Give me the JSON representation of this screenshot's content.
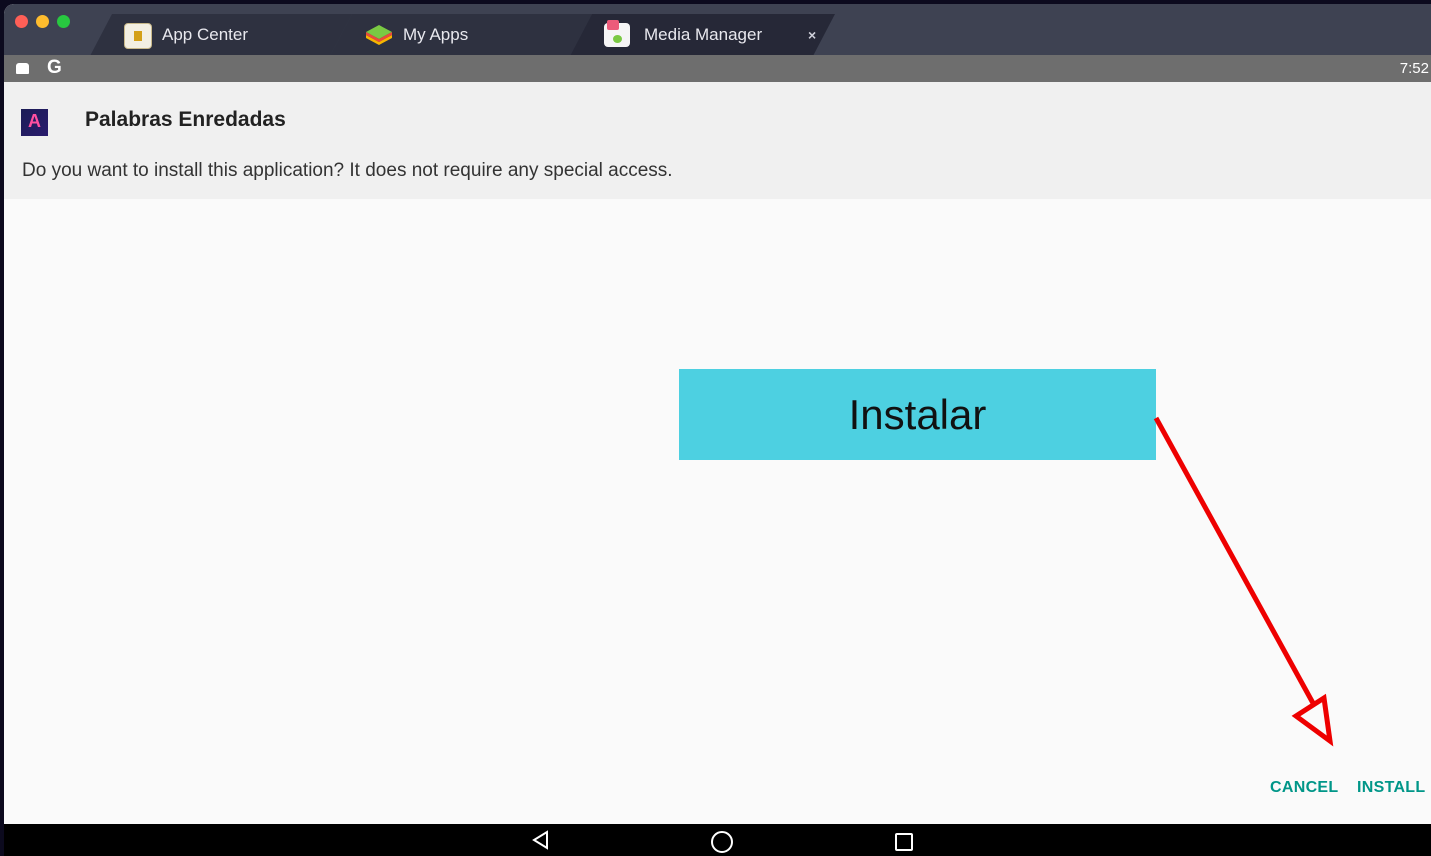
{
  "tabs": [
    {
      "label": "App Center",
      "icon": "app-center-icon",
      "active": false
    },
    {
      "label": "My Apps",
      "icon": "my-apps-icon",
      "active": false
    },
    {
      "label": "Media Manager",
      "icon": "media-manager-icon",
      "active": true,
      "close": "×"
    }
  ],
  "statusbar": {
    "carrier": "G",
    "time": "7:52"
  },
  "dialog": {
    "app_name": "Palabras Enredadas",
    "app_icon_letter": "A",
    "prompt": "Do you want to install this application? It does not require any special access.",
    "cancel_label": "CANCEL",
    "install_label": "INSTALL"
  },
  "annotation": {
    "label": "Instalar",
    "arrow_color": "#ee0000"
  },
  "colors": {
    "accent": "#009688",
    "overlay": "#4dd0e1",
    "tabbar": "#3e4252"
  },
  "navbar": {
    "icons": [
      "back-icon",
      "home-icon",
      "recents-icon"
    ]
  }
}
